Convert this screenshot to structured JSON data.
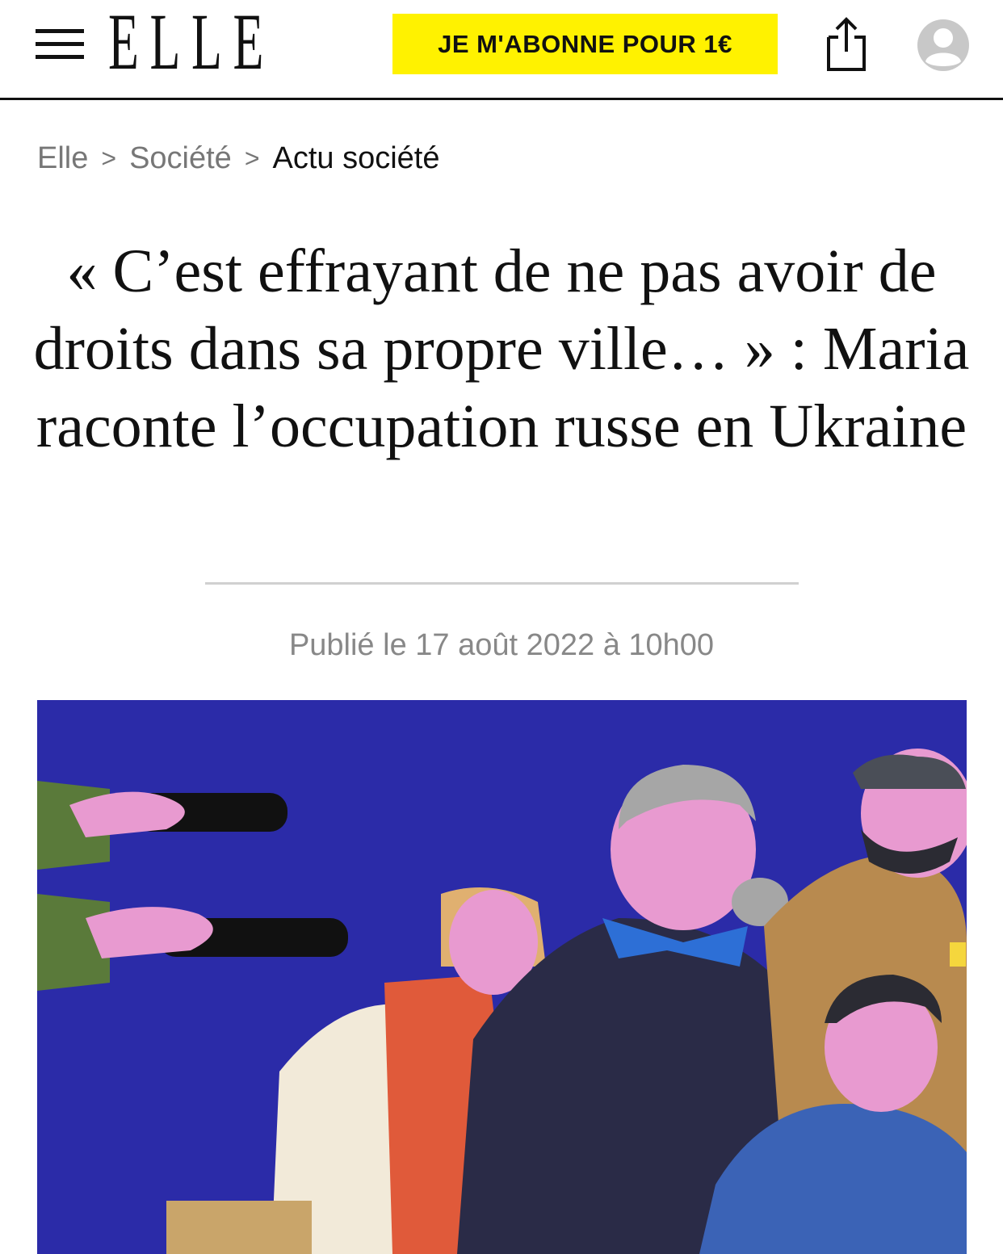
{
  "header": {
    "logo": "ELLE",
    "subscribe_label": "JE M'ABONNE POUR 1€",
    "icons": {
      "menu": "hamburger-menu-icon",
      "share": "share-icon",
      "account": "user-avatar-icon"
    }
  },
  "breadcrumb": {
    "items": [
      "Elle",
      "Société",
      "Actu société"
    ],
    "separator": ">"
  },
  "article": {
    "title": "« C’est effrayant de ne pas avoir de droits dans sa propre ville… » : Maria raconte l’occupation russe en Ukraine",
    "published": "Publié le 17 août 2022 à 10h00",
    "hero_image": "illustration: armed hands pointing at a group of Ukrainian civilians"
  },
  "colors": {
    "subscribe_bg": "#fff200",
    "hero_bg": "#2b2ba8",
    "text": "#111111",
    "muted": "#777777"
  }
}
